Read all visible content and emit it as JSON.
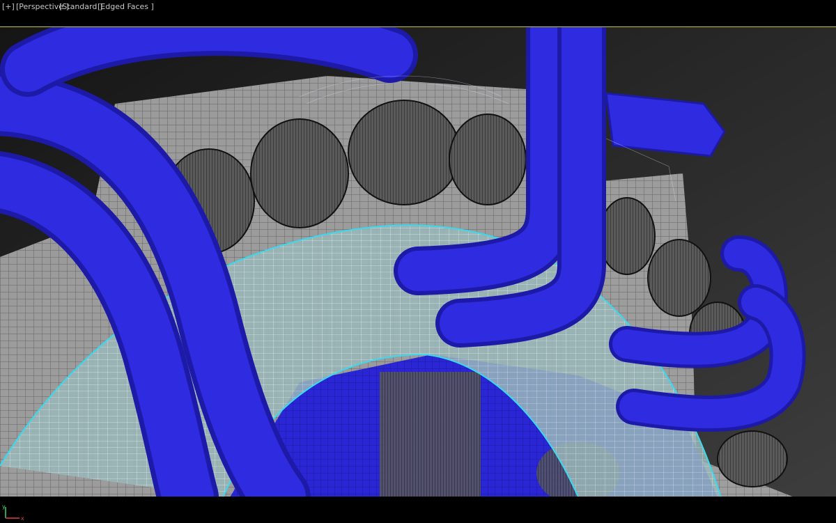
{
  "viewport": {
    "menu_label": "[+]",
    "view_label": "[Perspective ]",
    "shading_label": "[Standard ]",
    "display_label": "[Edged Faces ]"
  },
  "axis": {
    "y_label": "y",
    "x_label": "x"
  },
  "colors": {
    "pipe_blue": "#2a26d6",
    "selection_cyan": "#39d9ef",
    "viewport_border": "#c9c24a",
    "mesh_grey": "#b9b9b9"
  }
}
